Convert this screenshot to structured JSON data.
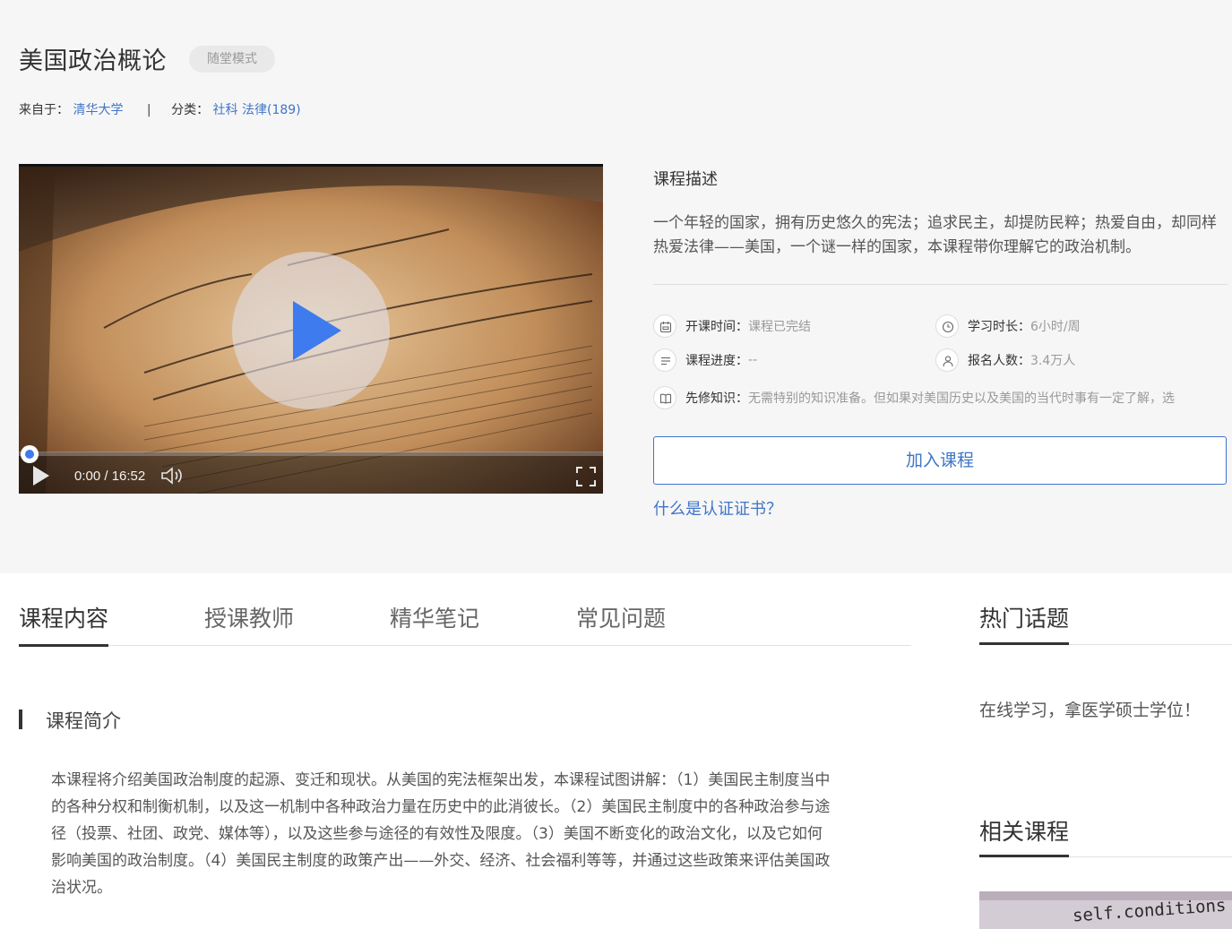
{
  "course": {
    "title": "美国政治概论",
    "mode_badge": "随堂模式",
    "source_label": "来自于：",
    "source_value": "清华大学",
    "separator": "|",
    "category_label": "分类：",
    "category_value": "社科 法律(189)"
  },
  "video": {
    "time": "0:00 / 16:52",
    "progress": 0
  },
  "description": {
    "title": "课程描述",
    "text": "一个年轻的国家，拥有历史悠久的宪法；追求民主，却提防民粹；热爱自由，却同样热爱法律——美国，一个谜一样的国家，本课程带你理解它的政治机制。"
  },
  "info": {
    "start_label": "开课时间：",
    "start_value": "课程已完结",
    "duration_label": "学习时长：",
    "duration_value": "6小时/周",
    "progress_label": "课程进度：",
    "progress_value": "--",
    "enrolled_label": "报名人数：",
    "enrolled_value": "3.4万人",
    "prereq_label": "先修知识：",
    "prereq_value": "无需特别的知识准备。但如果对美国历史以及美国的当代时事有一定了解，选"
  },
  "actions": {
    "join": "加入课程",
    "cert_link": "什么是认证证书？"
  },
  "tabs": [
    "课程内容",
    "授课教师",
    "精华笔记",
    "常见问题"
  ],
  "sidebar": {
    "hot_topics_title": "热门话题",
    "hot_topic_item": "在线学习，拿医学硕士学位！",
    "related_title": "相关课程",
    "thumb_text": "self.conditions"
  },
  "intro": {
    "title": "课程简介",
    "text": "本课程将介绍美国政治制度的起源、变迁和现状。从美国的宪法框架出发，本课程试图讲解：（1）美国民主制度当中的各种分权和制衡机制，以及这一机制中各种政治力量在历史中的此消彼长。（2）美国民主制度中的各种政治参与途径（投票、社团、政党、媒体等），以及这些参与途径的有效性及限度。（3）美国不断变化的政治文化，以及它如何影响美国的政治制度。（4）美国民主制度的政策产出——外交、经济、社会福利等等，并通过这些政策来评估美国政治状况。"
  },
  "colors": {
    "accent": "#3e75c9",
    "play_blue": "#3d7bef",
    "top_bg": "#f6f6f6"
  }
}
